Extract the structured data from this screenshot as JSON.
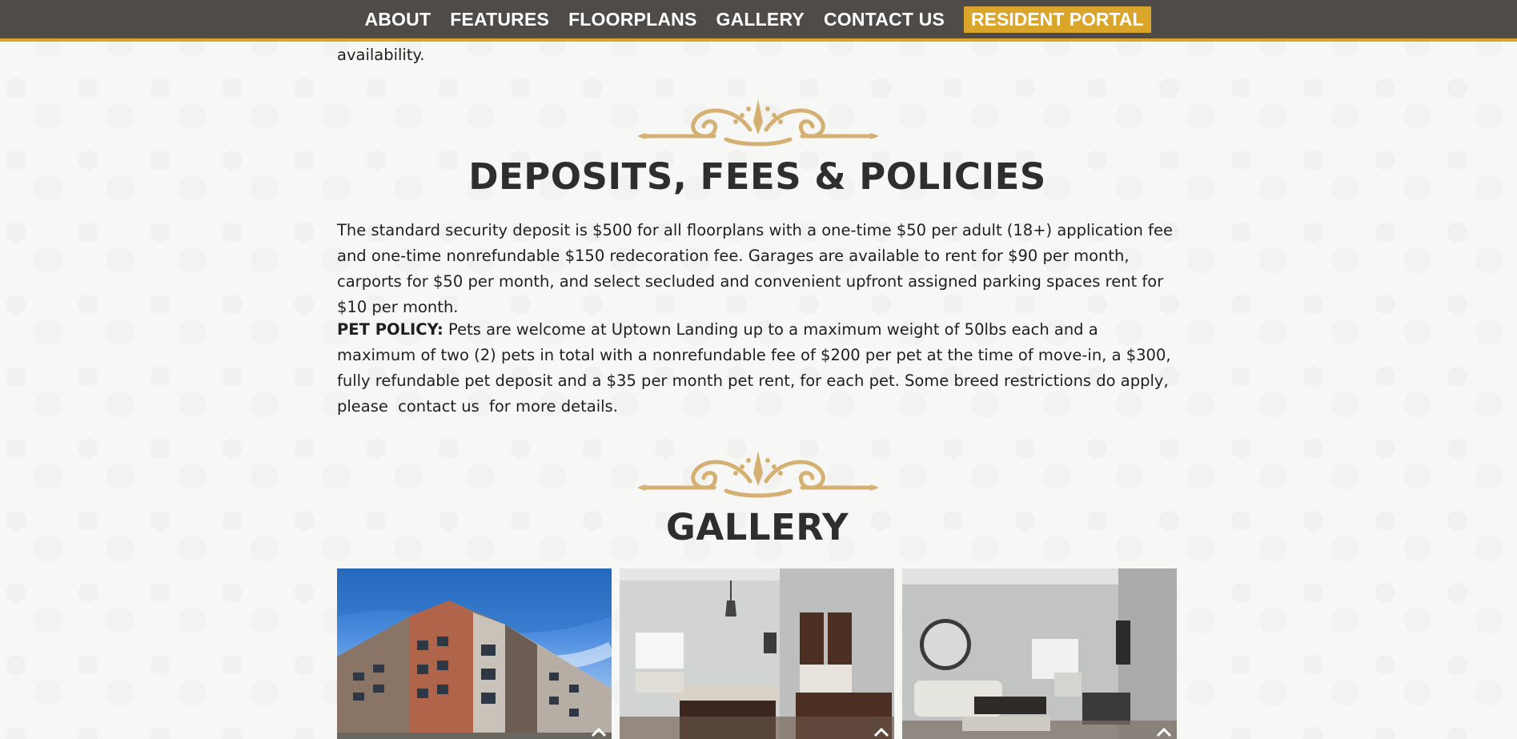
{
  "nav": {
    "items": [
      "ABOUT",
      "FEATURES",
      "FLOORPLANS",
      "GALLERY",
      "CONTACT US"
    ],
    "portal_label": "RESIDENT PORTAL"
  },
  "leftover_text": "availability.",
  "deposits": {
    "title": "DEPOSITS, FEES & POLICIES",
    "paragraph": "The standard security deposit is $500 for all floorplans with a one-time $50 per adult (18+) application fee and one-time nonrefundable $150 redecoration fee. Garages are available to rent for $90 per month, carports for $50 per month, and select secluded and convenient upfront assigned parking spaces rent for $10 per month.",
    "pet_policy_label": "PET POLICY:",
    "pet_policy_text": "Pets are welcome at Uptown Landing up to a maximum weight of 50lbs each and a maximum of two (2) pets in total with a nonrefundable fee of $200 per pet at the time of move-in, a $300, fully refundable pet deposit and a $35 per month pet rent, for each pet. Some breed restrictions do apply, please",
    "contact_link": "contact us",
    "pet_policy_end": "for more details."
  },
  "gallery": {
    "title": "GALLERY",
    "images": [
      "building-exterior",
      "kitchen-interior",
      "living-room-interior"
    ]
  },
  "colors": {
    "nav_bg": "#4f4b48",
    "accent": "#d9a52b",
    "ornament": "#d4b173",
    "heading": "#2e2e2e"
  }
}
